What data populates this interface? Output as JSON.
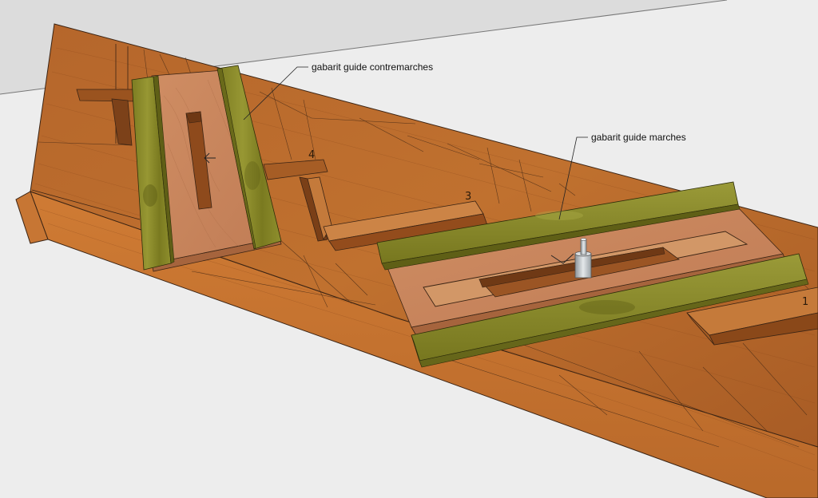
{
  "labels": {
    "riser_jig": "gabarit guide contremarches",
    "tread_jig": "gabarit guide marches"
  },
  "step_numbers": [
    "4",
    "3",
    "1"
  ],
  "colors": {
    "background": "#ffffff",
    "ground_plane": "#ebebeb",
    "backdrop": "#dcdcdc",
    "wood_top": "#b86a2e",
    "wood_side": "#c47230",
    "plywood": "#c9875f",
    "guide_rail": "#8c8c2a",
    "router_bit": "#bfc4c8"
  },
  "icons": [
    "router-bit-icon"
  ]
}
